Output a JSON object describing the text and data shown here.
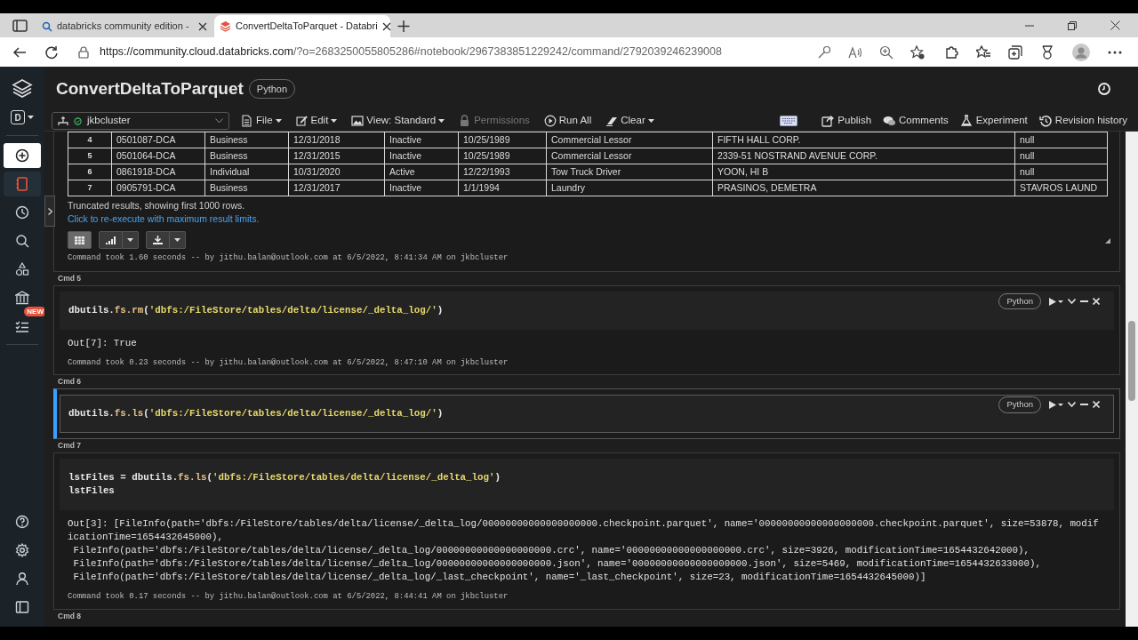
{
  "browser": {
    "tabs": [
      {
        "title": "databricks community edition -",
        "kind": "search",
        "selected": false
      },
      {
        "title": "ConvertDeltaToParquet - Databri",
        "kind": "brand",
        "selected": true
      }
    ],
    "url_host": "https://community.cloud.databricks.com",
    "url_rest": "/?o=2683250055805286#notebook/2967383851229242/command/2792039246239008"
  },
  "sidebar": {
    "items": [
      {
        "kind": "create",
        "selected": true
      },
      {
        "kind": "notebook",
        "selected": false
      },
      {
        "kind": "recents",
        "selected": false
      },
      {
        "kind": "search",
        "selected": false
      },
      {
        "kind": "shapes",
        "selected": false
      },
      {
        "kind": "org",
        "selected": false
      },
      {
        "kind": "tasks",
        "selected": false,
        "badge": "NEW"
      }
    ],
    "bottom_items": [
      {
        "kind": "help"
      },
      {
        "kind": "settings"
      },
      {
        "kind": "user"
      },
      {
        "kind": "panel"
      }
    ],
    "workspace_letter": "D"
  },
  "notebook": {
    "title": "ConvertDeltaToParquet",
    "language": "Python"
  },
  "toolbar": {
    "cluster": "jkbcluster",
    "cluster_running": true,
    "menus": [
      {
        "label": "File",
        "kind": "file",
        "dropdown": true,
        "disabled": false
      },
      {
        "label": "Edit",
        "kind": "edit",
        "dropdown": true,
        "disabled": false
      },
      {
        "label": "View: Standard",
        "kind": "view",
        "dropdown": true,
        "disabled": false
      },
      {
        "label": "Permissions",
        "kind": "lock",
        "dropdown": false,
        "disabled": true
      },
      {
        "label": "Run All",
        "kind": "run",
        "dropdown": false,
        "disabled": false
      },
      {
        "label": "Clear",
        "kind": "eraser",
        "dropdown": true,
        "disabled": false
      }
    ],
    "actions": [
      {
        "label": "Publish",
        "kind": "publish"
      },
      {
        "label": "Comments",
        "kind": "comments"
      },
      {
        "label": "Experiment",
        "kind": "flask"
      },
      {
        "label": "Revision history",
        "kind": "history"
      }
    ]
  },
  "result": {
    "rows": [
      [
        "4",
        "0501087-DCA",
        "Business",
        "12/31/2018",
        "Inactive",
        "10/25/1989",
        "Commercial Lessor",
        "FIFTH HALL CORP.",
        "null"
      ],
      [
        "5",
        "0501064-DCA",
        "Business",
        "12/31/2015",
        "Inactive",
        "10/25/1989",
        "Commercial Lessor",
        "2339-51 NOSTRAND AVENUE CORP.",
        "null"
      ],
      [
        "6",
        "0861918-DCA",
        "Individual",
        "10/31/2020",
        "Active",
        "12/22/1993",
        "Tow Truck Driver",
        "YOON, HI B",
        "null"
      ],
      [
        "7",
        "0905791-DCA",
        "Business",
        "12/31/2017",
        "Inactive",
        "1/1/1994",
        "Laundry",
        "PRASINOS, DEMETRA",
        "STAVROS LAUND"
      ]
    ],
    "notice": "Truncated results, showing first 1000 rows.",
    "link": "Click to re-execute with maximum result limits.",
    "view_buttons": [
      {
        "kind": "table",
        "selected": true
      },
      {
        "kind": "chart",
        "selected": false
      },
      {
        "kind": "download",
        "selected": false
      }
    ],
    "footer": "Command took 1.60 seconds -- by jithu.balan@outlook.com at 6/5/2022, 8:41:34 AM on jkbcluster"
  },
  "cells": [
    {
      "label": "Cmd 5",
      "focused": false,
      "controls_visible": true,
      "language": "Python",
      "code": [
        [
          {
            "kind": "plain",
            "text": "dbutils."
          },
          {
            "kind": "method",
            "text": "fs.rm"
          },
          {
            "kind": "plain",
            "text": "("
          },
          {
            "kind": "string",
            "text": "'dbfs:/FileStore/tables/delta/license/_delta_log/'"
          },
          {
            "kind": "plain",
            "text": ")"
          }
        ]
      ],
      "output": [
        "Out[7]: True"
      ],
      "footer": "Command took 0.23 seconds -- by jithu.balan@outlook.com at 6/5/2022, 8:47:10 AM on jkbcluster"
    },
    {
      "label": "Cmd 6",
      "focused": true,
      "controls_visible": true,
      "language": "Python",
      "code": [
        [
          {
            "kind": "plain",
            "text": "dbutils."
          },
          {
            "kind": "method",
            "text": "fs.ls"
          },
          {
            "kind": "plain",
            "text": "("
          },
          {
            "kind": "string",
            "text": "'dbfs:/FileStore/tables/delta/license/_delta_log/'"
          },
          {
            "kind": "plain",
            "text": ")"
          }
        ]
      ]
    },
    {
      "label": "Cmd 7",
      "focused": false,
      "controls_visible": false,
      "code": [
        [
          {
            "kind": "plain",
            "text": "lstFiles = dbutils."
          },
          {
            "kind": "method",
            "text": "fs.ls"
          },
          {
            "kind": "plain",
            "text": "("
          },
          {
            "kind": "string",
            "text": "'dbfs:/FileStore/tables/delta/license/_delta_log'"
          },
          {
            "kind": "plain",
            "text": ")"
          }
        ],
        [
          {
            "kind": "plain",
            "text": "lstFiles"
          }
        ]
      ],
      "output": [
        "Out[3]: [FileInfo(path='dbfs:/FileStore/tables/delta/license/_delta_log/00000000000000000000.checkpoint.parquet', name='00000000000000000000.checkpoint.parquet', size=53878, modif",
        "icationTime=1654432645000),",
        " FileInfo(path='dbfs:/FileStore/tables/delta/license/_delta_log/00000000000000000000.crc', name='00000000000000000000.crc', size=3926, modificationTime=1654432642000),",
        " FileInfo(path='dbfs:/FileStore/tables/delta/license/_delta_log/00000000000000000000.json', name='00000000000000000000.json', size=5469, modificationTime=1654432633000),",
        " FileInfo(path='dbfs:/FileStore/tables/delta/license/_delta_log/_last_checkpoint', name='_last_checkpoint', size=23, modificationTime=1654432645000)]"
      ],
      "footer": "Command took 0.17 seconds -- by jithu.balan@outlook.com at 6/5/2022, 8:44:41 AM on jkbcluster"
    },
    {
      "label": "Cmd 8"
    }
  ]
}
